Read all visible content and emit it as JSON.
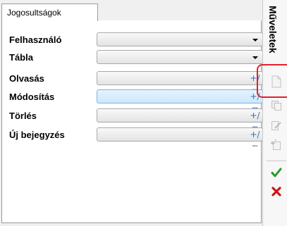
{
  "tab": {
    "label": "Jogosultságok"
  },
  "form": {
    "rows": [
      {
        "label": "Felhasználó",
        "type": "dropdown",
        "value": ""
      },
      {
        "label": "Tábla",
        "type": "dropdown",
        "value": ""
      },
      {
        "label": "Olvasás",
        "type": "toggle",
        "value": "",
        "toggle_glyph": "+/−"
      },
      {
        "label": "Módosítás",
        "type": "toggle",
        "value": "",
        "toggle_glyph": "+/−",
        "focused": true
      },
      {
        "label": "Törlés",
        "type": "toggle",
        "value": "",
        "toggle_glyph": "+/−"
      },
      {
        "label": "Új bejegyzés",
        "type": "toggle",
        "value": "",
        "toggle_glyph": "+/−"
      }
    ]
  },
  "sidebar": {
    "title": "Műveletek",
    "buttons": [
      {
        "icon": "new-document-icon",
        "enabled": false
      },
      {
        "icon": "copy-icon",
        "enabled": false
      },
      {
        "icon": "edit-icon",
        "enabled": false
      },
      {
        "icon": "undo-icon",
        "enabled": false
      },
      {
        "icon": "check-icon",
        "enabled": true,
        "color": "#2a9a2a"
      },
      {
        "icon": "cross-icon",
        "enabled": true,
        "color": "#c41a1a"
      }
    ]
  },
  "colors": {
    "highlight": "#e1212a",
    "focus_fill": "#cde8fb",
    "check": "#2a9a2a",
    "cross": "#c41a1a"
  }
}
